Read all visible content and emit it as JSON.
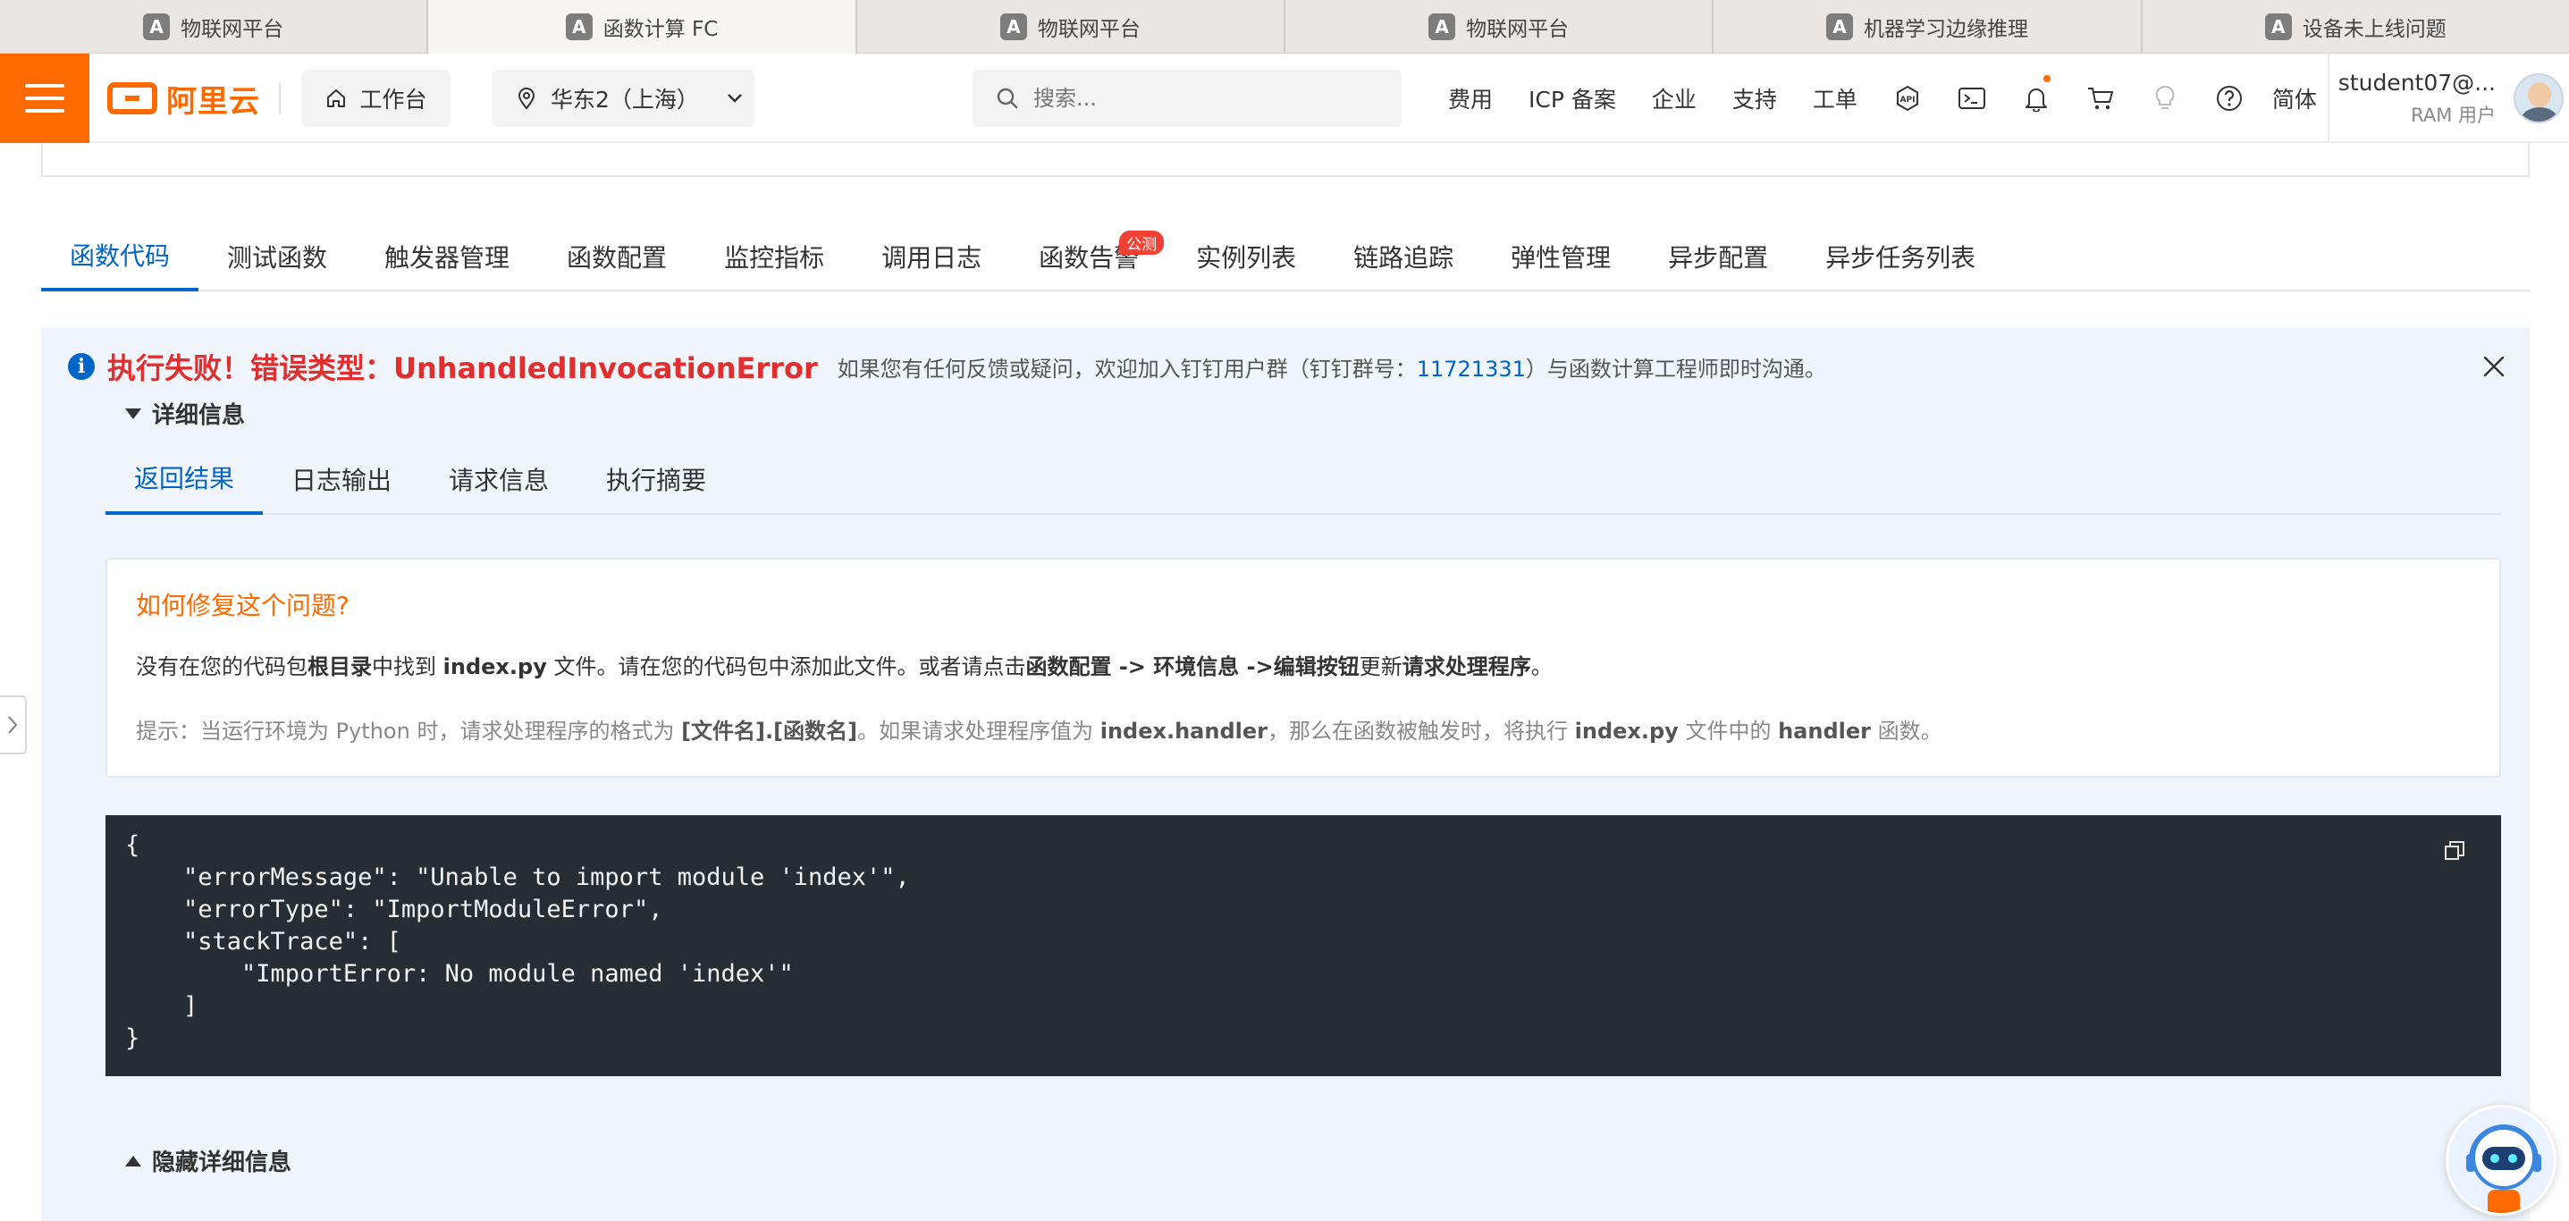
{
  "browser_tabs": [
    {
      "favicon": "A",
      "label": "物联网平台"
    },
    {
      "favicon": "A",
      "label": "函数计算 FC",
      "active": true
    },
    {
      "favicon": "A",
      "label": "物联网平台"
    },
    {
      "favicon": "A",
      "label": "物联网平台"
    },
    {
      "favicon": "A",
      "label": "机器学习边缘推理"
    },
    {
      "favicon": "A",
      "label": "设备未上线问题"
    }
  ],
  "topbar": {
    "logo_text": "阿里云",
    "workbench_label": "工作台",
    "region_label": "华东2（上海）",
    "search_placeholder": "搜索...",
    "links": [
      "费用",
      "ICP 备案",
      "企业",
      "支持",
      "工单"
    ],
    "lang": "简体",
    "user_name": "student07@...",
    "user_role": "RAM 用户",
    "accent_color": "#ff6a00"
  },
  "function_tabs": [
    {
      "label": "函数代码",
      "active": true
    },
    {
      "label": "测试函数"
    },
    {
      "label": "触发器管理"
    },
    {
      "label": "函数配置"
    },
    {
      "label": "监控指标"
    },
    {
      "label": "调用日志"
    },
    {
      "label": "函数告警",
      "badge": "公测"
    },
    {
      "label": "实例列表"
    },
    {
      "label": "链路追踪"
    },
    {
      "label": "弹性管理"
    },
    {
      "label": "异步配置"
    },
    {
      "label": "异步任务列表"
    }
  ],
  "result": {
    "title": "执行失败！错误类型：UnhandledInvocationError",
    "note_before": "如果您有任何反馈或疑问，欢迎加入钉钉用户群（钉钉群号：",
    "group_number": "11721331",
    "note_after": "）与函数计算工程师即时沟通。",
    "details_label": "详细信息",
    "hide_details_label": "隐藏详细信息",
    "error_color": "#e12e2e"
  },
  "sub_tabs": [
    {
      "label": "返回结果",
      "active": true
    },
    {
      "label": "日志输出"
    },
    {
      "label": "请求信息"
    },
    {
      "label": "执行摘要"
    }
  ],
  "fix": {
    "title": "如何修复这个问题?",
    "desc": [
      {
        "t": "没有在您的代码包",
        "b": false
      },
      {
        "t": "根目录",
        "b": true
      },
      {
        "t": "中找到 ",
        "b": false
      },
      {
        "t": "index.py",
        "b": true
      },
      {
        "t": " 文件。请在您的代码包中添加此文件。或者请点击",
        "b": false
      },
      {
        "t": "函数配置 -> 环境信息 ->编辑按钮",
        "b": true
      },
      {
        "t": "更新",
        "b": false
      },
      {
        "t": "请求处理程序",
        "b": true
      },
      {
        "t": "。",
        "b": false
      }
    ],
    "tip": [
      {
        "t": "提示：当运行环境为 Python 时，请求处理程序的格式为 ",
        "b": false
      },
      {
        "t": "[文件名].[函数名]",
        "b": true
      },
      {
        "t": "。如果请求处理程序值为 ",
        "b": false
      },
      {
        "t": "index.handler",
        "b": true
      },
      {
        "t": "，那么在函数被触发时，将执行 ",
        "b": false
      },
      {
        "t": "index.py",
        "b": true
      },
      {
        "t": " 文件中的 ",
        "b": false
      },
      {
        "t": "handler",
        "b": true
      },
      {
        "t": " 函数。",
        "b": false
      }
    ]
  },
  "code": "{\n    \"errorMessage\": \"Unable to import module 'index'\",\n    \"errorType\": \"ImportModuleError\",\n    \"stackTrace\": [\n        \"ImportError: No module named 'index'\"\n    ]\n}"
}
